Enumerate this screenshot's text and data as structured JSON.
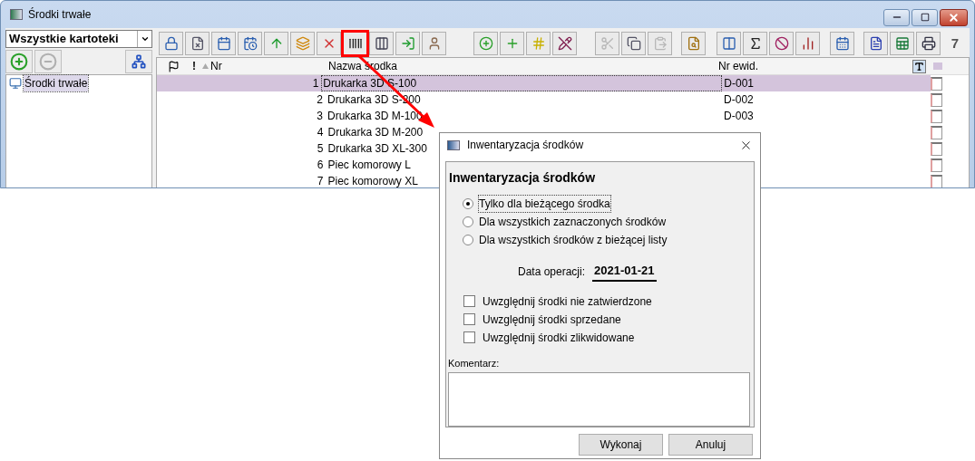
{
  "window": {
    "title": "Środki trwałe"
  },
  "left_panel": {
    "dropdown": {
      "value": "Wszystkie kartoteki"
    },
    "buttons": [
      {
        "disabled": false
      },
      {
        "disabled": true
      },
      {
        "disabled": false
      }
    ],
    "tree": [
      {
        "label": "Środki trwałe",
        "selected": true
      }
    ]
  },
  "toolbar": {
    "groups": [
      [
        {
          "disabled": false,
          "highlighted": false
        },
        {
          "disabled": false,
          "highlighted": false
        },
        {
          "disabled": false,
          "highlighted": false
        },
        {
          "disabled": false,
          "highlighted": false
        },
        {
          "disabled": false,
          "highlighted": false
        },
        {
          "disabled": false,
          "highlighted": false
        },
        {
          "disabled": false,
          "highlighted": false
        },
        {
          "disabled": false,
          "highlighted": true
        },
        {
          "disabled": false,
          "highlighted": false
        },
        {
          "disabled": false,
          "highlighted": false
        },
        {
          "disabled": false,
          "highlighted": false
        }
      ],
      [
        {
          "disabled": false,
          "highlighted": false
        },
        {
          "disabled": false,
          "highlighted": false
        },
        {
          "disabled": false,
          "highlighted": false
        },
        {
          "disabled": false,
          "highlighted": false
        }
      ],
      [
        {
          "disabled": true,
          "highlighted": false
        },
        {
          "disabled": false,
          "highlighted": false
        },
        {
          "disabled": true,
          "highlighted": false
        }
      ],
      [
        {
          "disabled": false,
          "highlighted": false
        }
      ],
      [
        {
          "disabled": false,
          "highlighted": false
        },
        {
          "disabled": false,
          "highlighted": false
        },
        {
          "disabled": false,
          "highlighted": false
        },
        {
          "disabled": false,
          "highlighted": false
        }
      ],
      [
        {
          "disabled": false,
          "highlighted": false
        }
      ],
      [
        {
          "disabled": false,
          "highlighted": false
        },
        {
          "disabled": false,
          "highlighted": false
        },
        {
          "disabled": false,
          "highlighted": false
        }
      ]
    ],
    "record_count": "7"
  },
  "table": {
    "columns": [
      "!",
      "Nr",
      "Nazwa środka",
      "Nr ewid."
    ],
    "rows": [
      {
        "nr": "1",
        "name": "Drukarka 3D S-100",
        "nr_ewid": "D-001",
        "selected": true
      },
      {
        "nr": "2",
        "name": "Drukarka 3D S-200",
        "nr_ewid": "D-002",
        "selected": false
      },
      {
        "nr": "3",
        "name": "Drukarka 3D M-100",
        "nr_ewid": "D-003",
        "selected": false
      },
      {
        "nr": "4",
        "name": "Drukarka 3D M-200",
        "selected": false
      },
      {
        "nr": "5",
        "name": "Drukarka 3D XL-300",
        "selected": false
      },
      {
        "nr": "6",
        "name": "Piec komorowy L",
        "selected": false
      },
      {
        "nr": "7",
        "name": "Piec komorowy XL",
        "selected": false
      }
    ]
  },
  "dialog": {
    "title": "Inwentaryzacja środków",
    "heading": "Inwentaryzacja środków",
    "radios": [
      {
        "label": "Tylko dla bieżącego środka",
        "selected": true
      },
      {
        "label": "Dla wszystkich zaznaczonych środków",
        "selected": false
      },
      {
        "label": "Dla wszystkich środków z bieżącej listy",
        "selected": false
      }
    ],
    "date_label": "Data operacji:",
    "date_value": "2021-01-21",
    "checkboxes": [
      {
        "label": "Uwzględnij środki nie zatwierdzone",
        "checked": false
      },
      {
        "label": "Uwzględnij środki sprzedane",
        "checked": false
      },
      {
        "label": "Uwzględnij środki zlikwidowane",
        "checked": false
      }
    ],
    "comment_label": "Komentarz:",
    "buttons": [
      "Wykonaj",
      "Anuluj"
    ]
  }
}
